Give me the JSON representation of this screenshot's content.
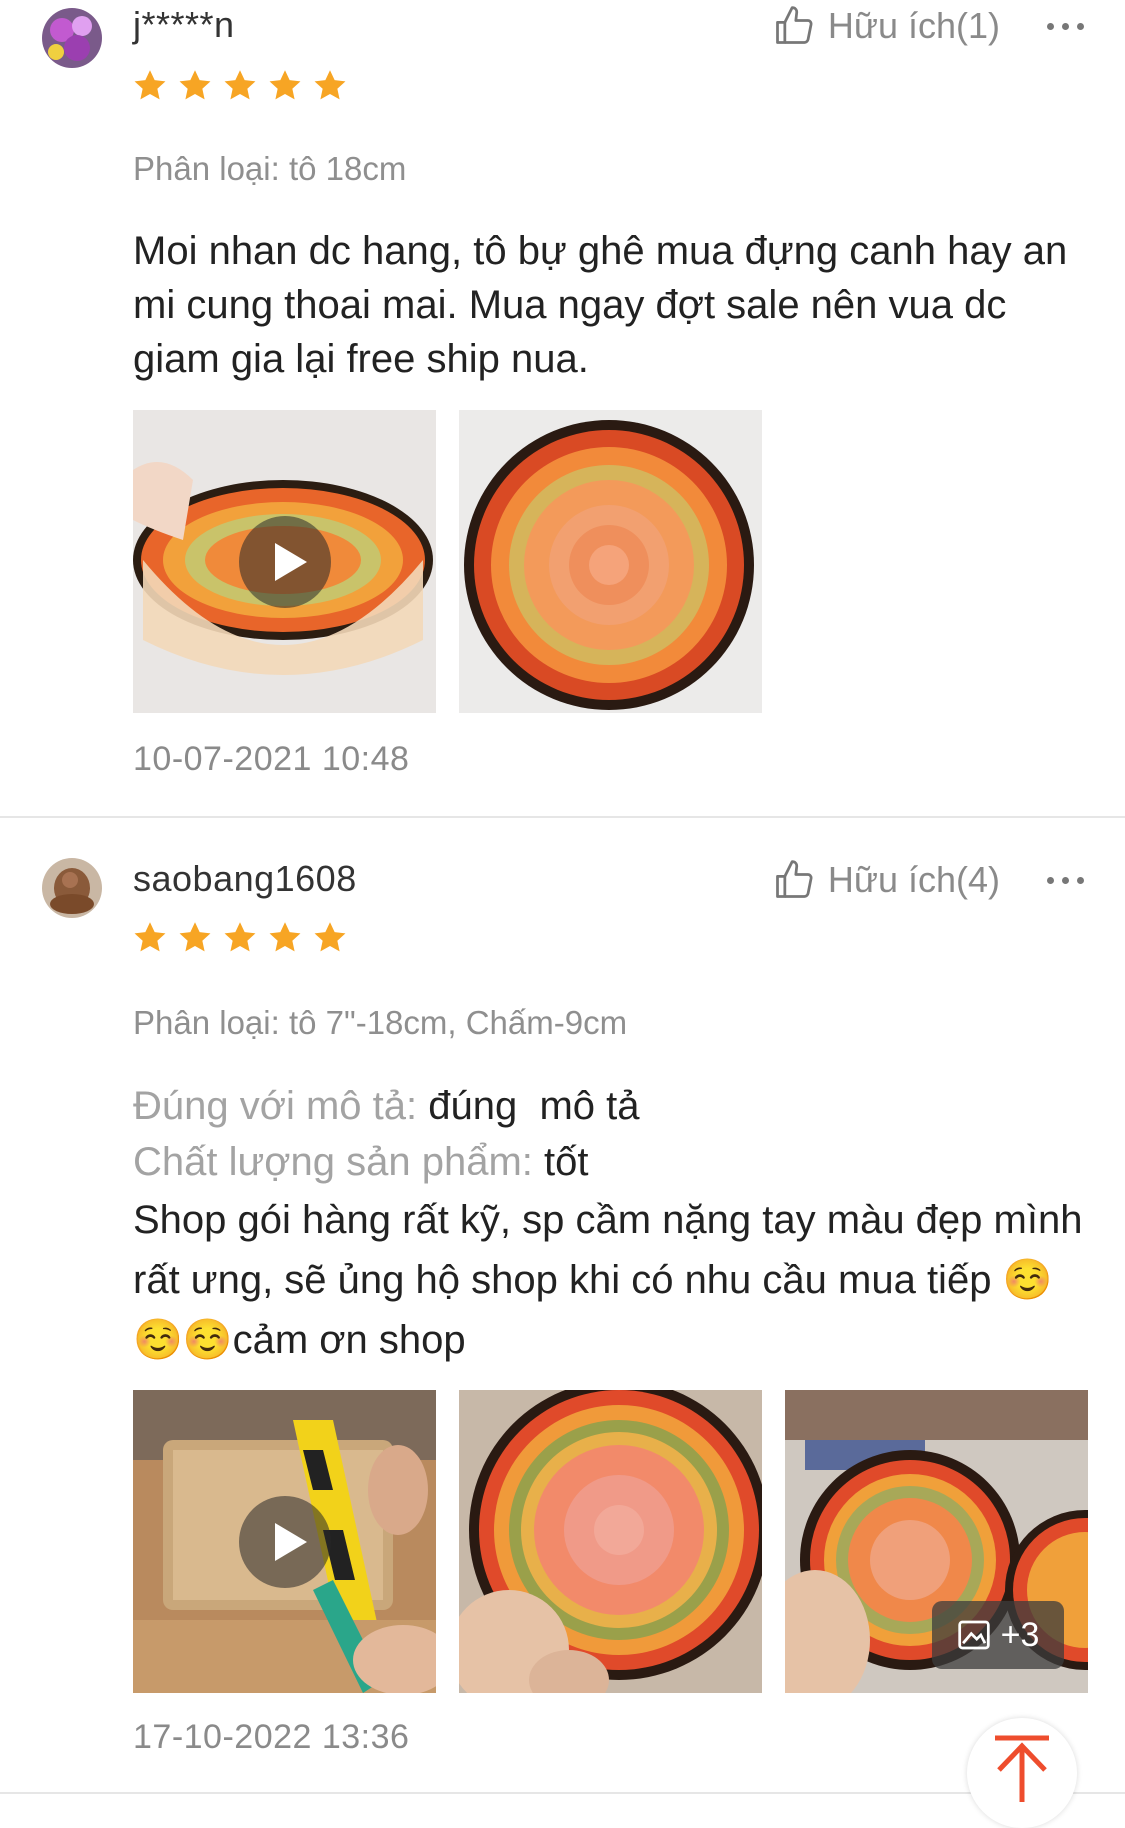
{
  "reviews": [
    {
      "username": "j*****n",
      "rating": 5,
      "helpful_label": "Hữu ích",
      "helpful_count": "(1)",
      "variant": "Phân loại: tô 18cm",
      "text": "Moi nhan dc hang, tô bự ghê mua đựng canh hay an mi cung thoai mai. Mua ngay đợt sale nên vua dc giam gia lại free ship nua.",
      "date": "10-07-2021 10:48"
    },
    {
      "username": "saobang1608",
      "rating": 5,
      "helpful_label": "Hữu ích",
      "helpful_count": "(4)",
      "variant": "Phân loại: tô 7\"-18cm, Chấm-9cm",
      "desc_label": "Đúng với mô tả:",
      "desc_value": "đúng  mô tả",
      "quality_label": "Chất lượng sản phẩm:",
      "quality_value": "tốt",
      "text": "Shop gói hàng rất kỹ, sp cầm nặng tay màu đẹp mình rất ưng, sẽ ủng hộ shop khi có nhu cầu mua tiếp ☺️☺️☺️cảm ơn shop",
      "extra_media": "+3",
      "date": "17-10-2022 13:36"
    }
  ],
  "colors": {
    "star": "#f7a524",
    "accent": "#ee4d2d",
    "muted": "#8a8a8a"
  }
}
